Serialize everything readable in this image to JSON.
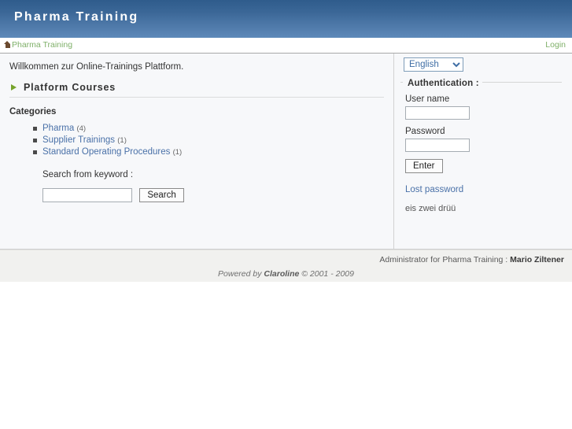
{
  "header": {
    "site_title": "Pharma Training",
    "accent_color": "#3a6696"
  },
  "breadcrumb": {
    "home_icon": "home-icon",
    "items": [
      {
        "label": "Pharma Training"
      }
    ],
    "login_label": "Login",
    "link_color": "#7fb069"
  },
  "main": {
    "welcome_text": "Willkommen zur Online-Trainings Plattform.",
    "section_heading": "Platform Courses",
    "section_icon": "triangle-right-icon",
    "categories_label": "Categories",
    "categories": [
      {
        "name": "Pharma",
        "count": "(4)"
      },
      {
        "name": "Supplier Trainings",
        "count": "(1)"
      },
      {
        "name": "Standard Operating Procedures",
        "count": "(1)"
      }
    ],
    "search": {
      "label": "Search from keyword :",
      "value": "",
      "placeholder": "",
      "button_label": "Search"
    }
  },
  "sidebar": {
    "language": {
      "selected": "English",
      "options": [
        "English"
      ]
    },
    "auth": {
      "legend": "Authentication :",
      "username_label": "User name",
      "username_value": "",
      "password_label": "Password",
      "password_value": "",
      "submit_label": "Enter"
    },
    "lost_password_label": "Lost password",
    "tagline": "eis zwei drüü"
  },
  "footer": {
    "admin_prefix": "Administrator for Pharma Training : ",
    "admin_name": "Mario Ziltener",
    "powered_prefix": "Powered by ",
    "powered_brand": "Claroline",
    "powered_suffix": " © 2001 - 2009"
  }
}
